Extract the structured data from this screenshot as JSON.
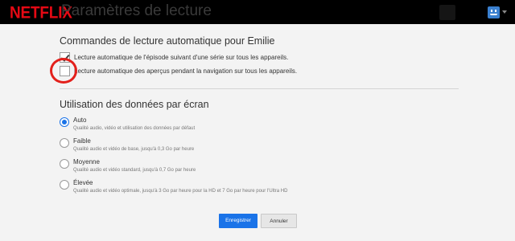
{
  "header": {
    "logo": "NETFLIX",
    "title": "Paramètres de lecture"
  },
  "autoplay": {
    "title": "Commandes de lecture automatique pour Emilie",
    "options": [
      {
        "label": "Lecture automatique de l'épisode suivant d'une série sur tous les appareils.",
        "checked": true
      },
      {
        "label": "Lecture automatique des aperçus pendant la navigation sur tous les appareils.",
        "checked": false
      }
    ]
  },
  "data_usage": {
    "title": "Utilisation des données par écran",
    "options": [
      {
        "label": "Auto",
        "desc": "Qualité audio, vidéo et utilisation des données par défaut",
        "selected": true
      },
      {
        "label": "Faible",
        "desc": "Qualité audio et vidéo de base, jusqu'à 0,3 Go par heure",
        "selected": false
      },
      {
        "label": "Moyenne",
        "desc": "Qualité audio et vidéo standard, jusqu'à 0,7 Go par heure",
        "selected": false
      },
      {
        "label": "Élevée",
        "desc": "Qualité audio et vidéo optimale, jusqu'à 3 Go par heure pour la HD et 7 Go par heure pour l'Ultra HD",
        "selected": false
      }
    ]
  },
  "actions": {
    "save": "Enregistrer",
    "cancel": "Annuler"
  },
  "colors": {
    "brand": "#e50914",
    "accent": "#1a73e8",
    "highlight": "#e3201b"
  }
}
